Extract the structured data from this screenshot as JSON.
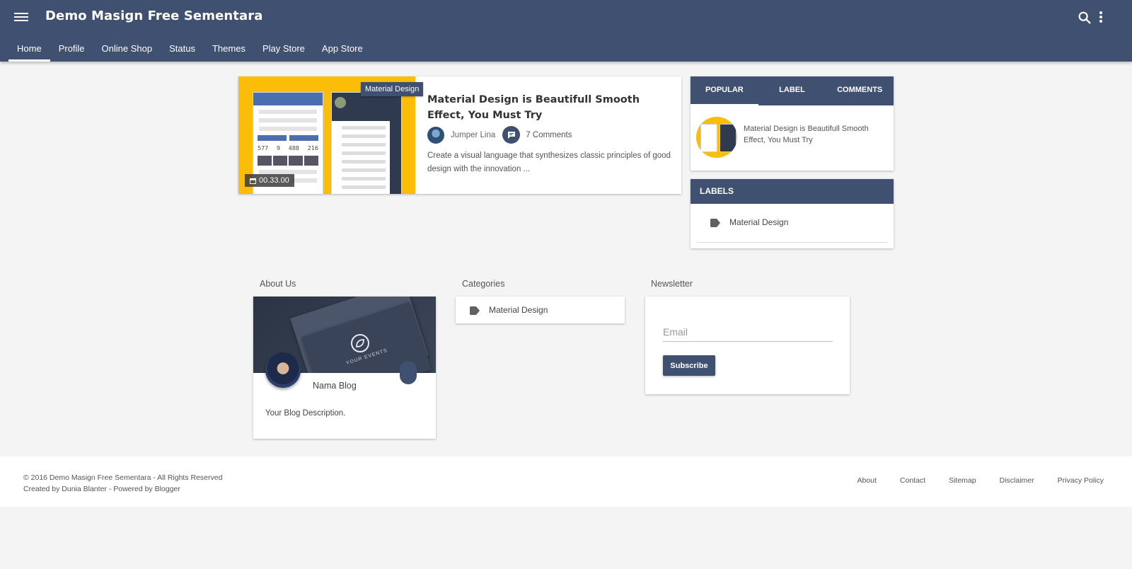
{
  "header": {
    "site_title": "Demo Masign Free Sementara",
    "nav": [
      "Home",
      "Profile",
      "Online Shop",
      "Status",
      "Themes",
      "Play Store",
      "App Store"
    ],
    "active_nav": "Home"
  },
  "post": {
    "label": "Material Design",
    "time": "00.33.00",
    "title": "Material Design is Beautifull Smooth Effect, You Must Try",
    "author": "Jumper Lina",
    "comments": "7 Comments",
    "excerpt": "Create a visual language that synthesizes classic principles of good design with the innovation ...",
    "thumb_stats": [
      "577",
      "9",
      "488",
      "216"
    ]
  },
  "sidebar": {
    "tabs": [
      "POPULAR",
      "LABEL",
      "COMMENTS"
    ],
    "active_tab": "POPULAR",
    "popular": [
      {
        "title": "Material Design is Beautifull Smooth Effect, You Must Try"
      }
    ],
    "labels_title": "LABELS",
    "labels": [
      "Material Design"
    ]
  },
  "widgets": {
    "about": {
      "title": "About Us",
      "blog_name": "Nama Blog",
      "description": "Your Blog Description.",
      "cover_text": "YOUR EVENTS"
    },
    "categories": {
      "title": "Categories",
      "items": [
        "Material Design"
      ]
    },
    "newsletter": {
      "title": "Newsletter",
      "email_placeholder": "Email",
      "subscribe_label": "Subscribe"
    }
  },
  "footer": {
    "copyright": "© 2016 Demo Masign Free Sementara - All Rights Reserved",
    "credits": "Created by Dunia Blanter - Powered by Blogger",
    "links": [
      "About",
      "Contact",
      "Sitemap",
      "Disclaimer",
      "Privacy Policy"
    ]
  },
  "colors": {
    "primary": "#3f5070",
    "accent": "#fbbd08",
    "background": "#f4f4f4"
  },
  "icons": {
    "menu": "menu-icon",
    "search": "search-icon",
    "more": "more-vert-icon",
    "calendar": "calendar-icon",
    "comment": "comment-icon",
    "tag": "tag-icon"
  }
}
